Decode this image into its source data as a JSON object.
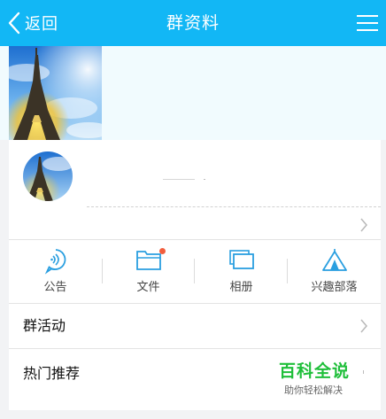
{
  "header": {
    "back_label": "返回",
    "title": "群资料",
    "menu_icon": "hamburger-icon"
  },
  "cover": {
    "photo_alt": "Eiffel Tower"
  },
  "group": {
    "avatar_alt": "Eiffel Tower"
  },
  "shortcuts": [
    {
      "label": "公告",
      "icon": "announcement-icon"
    },
    {
      "label": "文件",
      "icon": "folder-icon",
      "has_badge": true
    },
    {
      "label": "相册",
      "icon": "album-icon"
    },
    {
      "label": "兴趣部落",
      "icon": "tent-icon"
    }
  ],
  "rows": {
    "activity_label": "群活动",
    "hot_label": "热门推荐"
  },
  "promo": {
    "title": "百科全说",
    "subtitle": "助你轻松解决"
  },
  "colors": {
    "brand_blue": "#12b7f5",
    "icon_blue": "#2a9fe0",
    "promo_green": "#1fbf3a",
    "badge_red": "#f25e3d"
  }
}
